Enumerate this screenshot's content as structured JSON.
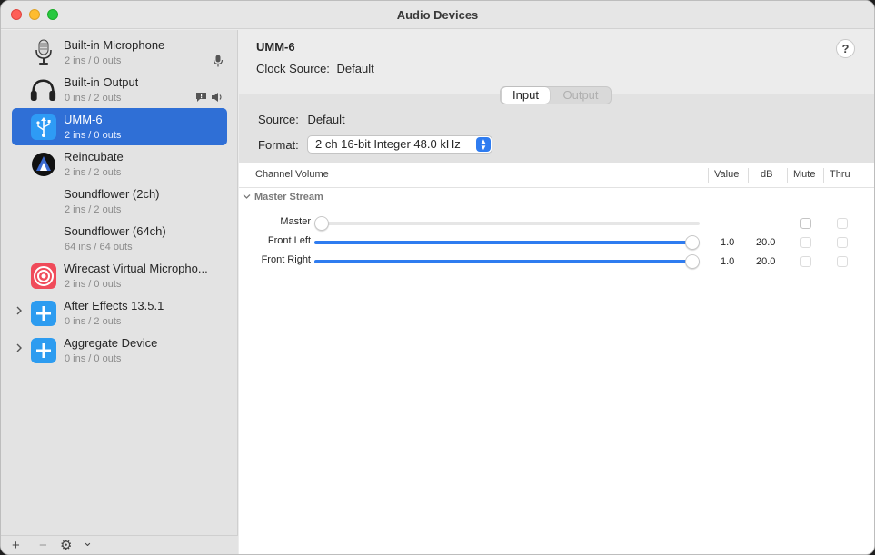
{
  "window": {
    "title": "Audio Devices"
  },
  "devices": [
    {
      "name": "Built-in Microphone",
      "io": "2 ins / 0 outs",
      "icon": "microphone-icon",
      "tail": [
        "mic-indicator-icon"
      ]
    },
    {
      "name": "Built-in Output",
      "io": "0 ins / 2 outs",
      "icon": "headphones-icon",
      "tail": [
        "alert-icon",
        "speaker-icon"
      ]
    },
    {
      "name": "UMM-6",
      "io": "2 ins / 0 outs",
      "icon": "usb-icon",
      "selected": true
    },
    {
      "name": "Reincubate",
      "io": "2 ins / 2 outs",
      "icon": "reincubate-icon"
    },
    {
      "name": "Soundflower (2ch)",
      "io": "2 ins / 2 outs"
    },
    {
      "name": "Soundflower (64ch)",
      "io": "64 ins / 64 outs"
    },
    {
      "name": "Wirecast Virtual Micropho...",
      "io": "2 ins / 0 outs",
      "icon": "wirecast-icon"
    },
    {
      "name": "After Effects 13.5.1",
      "io": "0 ins / 2 outs",
      "icon": "aggregate-plus-icon",
      "expandable": true
    },
    {
      "name": "Aggregate Device",
      "io": "0 ins / 0 outs",
      "icon": "aggregate-plus-icon",
      "expandable": true
    }
  ],
  "footer": {
    "add": "+",
    "remove": "−",
    "gear": "⚙",
    "menu": "⌄"
  },
  "detail": {
    "device_name": "UMM-6",
    "clock_source_label": "Clock Source:",
    "clock_source_value": "Default",
    "help": "?",
    "tabs": {
      "input": "Input",
      "output": "Output",
      "active": "Input"
    },
    "source_label": "Source:",
    "source_value": "Default",
    "format_label": "Format:",
    "format_value": "2 ch 16-bit Integer 48.0 kHz"
  },
  "table": {
    "headers": {
      "channel": "Channel Volume",
      "value": "Value",
      "db": "dB",
      "mute": "Mute",
      "thru": "Thru"
    },
    "group": "Master Stream",
    "rows": [
      {
        "label": "Master",
        "level": 0.0,
        "value": "",
        "db": "",
        "mute_enabled": true
      },
      {
        "label": "Front Left",
        "level": 1.0,
        "value": "1.0",
        "db": "20.0",
        "mute_enabled": false
      },
      {
        "label": "Front Right",
        "level": 1.0,
        "value": "1.0",
        "db": "20.0",
        "mute_enabled": false
      }
    ]
  },
  "colors": {
    "selection": "#2f6fd6",
    "accent": "#2f7cf0"
  }
}
